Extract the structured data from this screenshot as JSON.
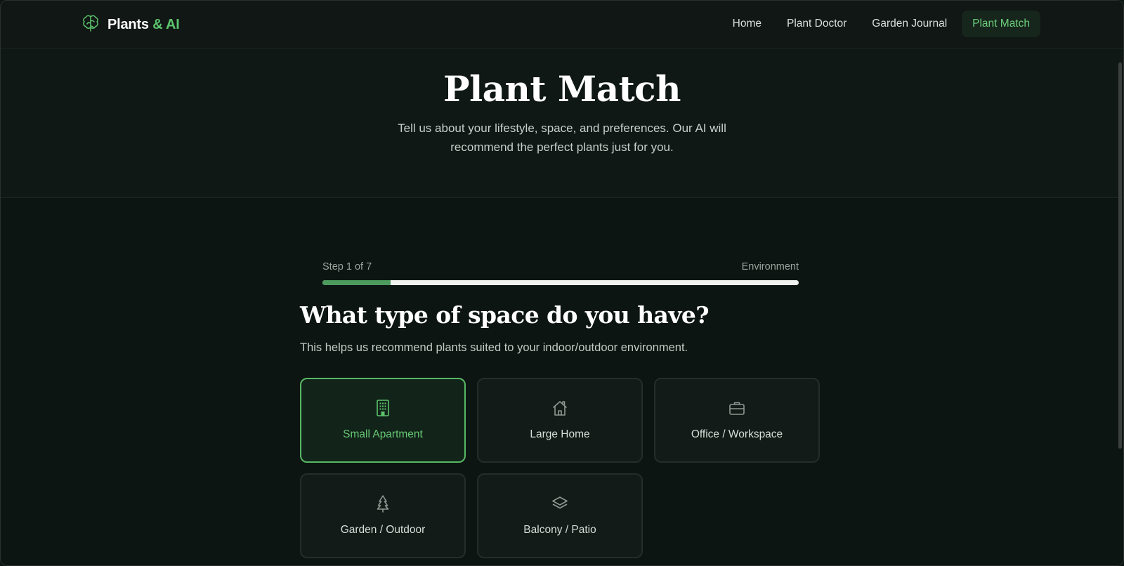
{
  "brand": {
    "name_main": "Plants",
    "name_accent": "& AI",
    "logo_icon": "brain-leaf-icon",
    "accent_color": "#5cc46c"
  },
  "nav": {
    "items": [
      {
        "label": "Home",
        "active": false
      },
      {
        "label": "Plant Doctor",
        "active": false
      },
      {
        "label": "Garden Journal",
        "active": false
      },
      {
        "label": "Plant Match",
        "active": true
      }
    ]
  },
  "hero": {
    "title": "Plant Match",
    "subtitle": "Tell us about your lifestyle, space, and preferences. Our AI will recommend the perfect plants just for you."
  },
  "progress": {
    "step_label": "Step 1 of 7",
    "step_name": "Environment",
    "fraction": 0.143,
    "fill_color": "#4c9a5d"
  },
  "question": {
    "title": "What type of space do you have?",
    "help": "This helps us recommend plants suited to your indoor/outdoor environment."
  },
  "options": [
    {
      "label": "Small Apartment",
      "icon": "building-icon",
      "selected": true
    },
    {
      "label": "Large Home",
      "icon": "home-icon",
      "selected": false
    },
    {
      "label": "Office / Workspace",
      "icon": "briefcase-icon",
      "selected": false
    },
    {
      "label": "Garden / Outdoor",
      "icon": "tree-icon",
      "selected": false
    },
    {
      "label": "Balcony / Patio",
      "icon": "layers-icon",
      "selected": false
    }
  ]
}
